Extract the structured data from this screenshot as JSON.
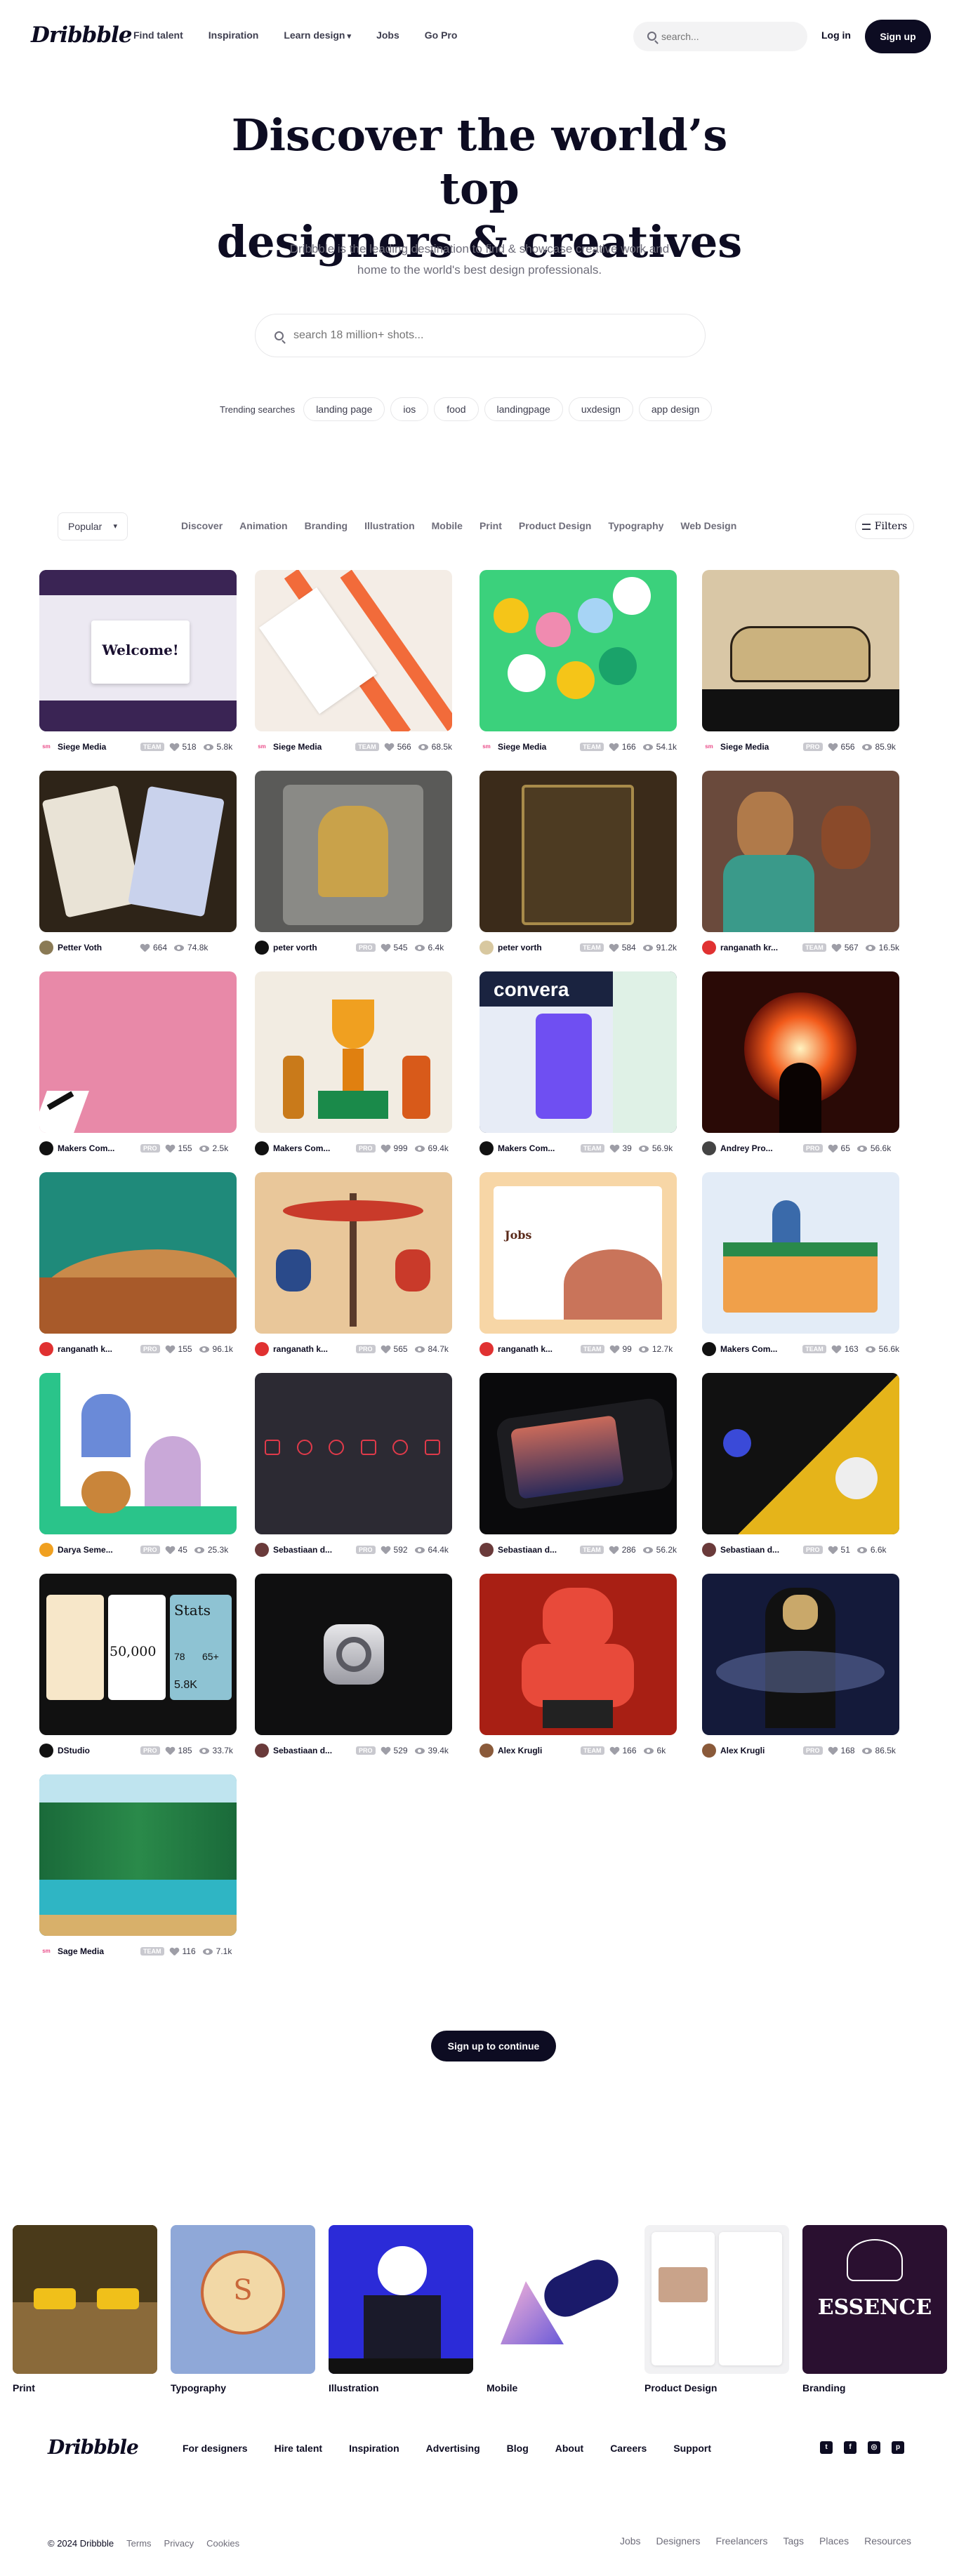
{
  "nav": {
    "logo": "Dribbble",
    "links": [
      "Find talent",
      "Inspiration",
      "Learn design",
      "Jobs",
      "Go Pro"
    ],
    "search_placeholder": "search...",
    "login": "Log in",
    "signup": "Sign up"
  },
  "hero": {
    "title_line1": "Discover the world’s top",
    "title_line2": "designers & creatives",
    "subtitle_line1": "Dribbble is the leading destination to find & showcase creative work and",
    "subtitle_line2": "home to the world's best design professionals.",
    "search_placeholder": "search 18 million+ shots...",
    "trending_label": "Trending searches",
    "trending": [
      "landing page",
      "ios",
      "food",
      "landingpage",
      "uxdesign",
      "app design"
    ]
  },
  "filters": {
    "sort": "Popular",
    "categories": [
      "Discover",
      "Animation",
      "Branding",
      "Illustration",
      "Mobile",
      "Print",
      "Product Design",
      "Typography",
      "Web Design"
    ],
    "filters_label": "Filters"
  },
  "shots": [
    {
      "author": "Siege Media",
      "badge": "TEAM",
      "likes": "518",
      "views": "5.8k",
      "av": "sm",
      "avcolor": "#ffffff",
      "bg": "#3a2454",
      "welcome": "Welcome!"
    },
    {
      "author": "Siege Media",
      "badge": "TEAM",
      "likes": "566",
      "views": "68.5k",
      "av": "sm",
      "avcolor": "#ffffff",
      "bg": "#f4ede6"
    },
    {
      "author": "Siege Media",
      "badge": "TEAM",
      "likes": "166",
      "views": "54.1k",
      "av": "sm",
      "avcolor": "#ffffff",
      "bg": "#3bd17c"
    },
    {
      "author": "Siege Media",
      "badge": "PRO",
      "likes": "656",
      "views": "85.9k",
      "av": "sm",
      "avcolor": "#ffffff",
      "bg": "#d9c7a6"
    },
    {
      "author": "Petter Voth",
      "badge": "",
      "likes": "664",
      "views": "74.8k",
      "av": "",
      "avcolor": "#8a7a55",
      "bg": "#2e2418"
    },
    {
      "author": "peter vorth",
      "badge": "PRO",
      "likes": "545",
      "views": "6.4k",
      "av": "",
      "avcolor": "#111111",
      "bg": "#5a5a58"
    },
    {
      "author": "peter vorth",
      "badge": "TEAM",
      "likes": "584",
      "views": "91.2k",
      "av": "",
      "avcolor": "#d8c8a0",
      "bg": "#3b2b1a"
    },
    {
      "author": "ranganath kr...",
      "badge": "TEAM",
      "likes": "567",
      "views": "16.5k",
      "av": "",
      "avcolor": "#e03131",
      "bg": "#6a4a3c"
    },
    {
      "author": "Makers Com...",
      "badge": "PRO",
      "likes": "155",
      "views": "2.5k",
      "av": "",
      "avcolor": "#111111",
      "bg": "#e889a8"
    },
    {
      "author": "Makers Com...",
      "badge": "PRO",
      "likes": "999",
      "views": "69.4k",
      "av": "",
      "avcolor": "#111111",
      "bg": "#f2ece2"
    },
    {
      "author": "Makers Com...",
      "badge": "TEAM",
      "likes": "39",
      "views": "56.9k",
      "av": "",
      "avcolor": "#111111",
      "bg": "#1a2340",
      "convera": "convera"
    },
    {
      "author": "Andrey Pro...",
      "badge": "PRO",
      "likes": "65",
      "views": "56.6k",
      "av": "",
      "avcolor": "#444444",
      "bg": "#2a0a06"
    },
    {
      "author": "ranganath k...",
      "badge": "PRO",
      "likes": "155",
      "views": "96.1k",
      "av": "",
      "avcolor": "#e03131",
      "bg": "#1f8a7a"
    },
    {
      "author": "ranganath k...",
      "badge": "PRO",
      "likes": "565",
      "views": "84.7k",
      "av": "",
      "avcolor": "#e03131",
      "bg": "#e9c79a"
    },
    {
      "author": "ranganath k...",
      "badge": "TEAM",
      "likes": "99",
      "views": "12.7k",
      "av": "",
      "avcolor": "#e03131",
      "bg": "#f1e4d2",
      "jobs": "Jobs"
    },
    {
      "author": "Makers Com...",
      "badge": "TEAM",
      "likes": "163",
      "views": "56.6k",
      "av": "",
      "avcolor": "#111111",
      "bg": "#e3ecf7"
    },
    {
      "author": "Darya Seme...",
      "badge": "PRO",
      "likes": "45",
      "views": "25.3k",
      "av": "",
      "avcolor": "#f0a020",
      "bg": "#ffffff"
    },
    {
      "author": "Sebastiaan d...",
      "badge": "PRO",
      "likes": "592",
      "views": "64.4k",
      "av": "",
      "avcolor": "#6a3a3a",
      "bg": "#2c2a33"
    },
    {
      "author": "Sebastiaan d...",
      "badge": "TEAM",
      "likes": "286",
      "views": "56.2k",
      "av": "",
      "avcolor": "#6a3a3a",
      "bg": "#0a0a0c"
    },
    {
      "author": "Sebastiaan d...",
      "badge": "PRO",
      "likes": "51",
      "views": "6.6k",
      "av": "",
      "avcolor": "#6a3a3a",
      "bg": "#111111"
    },
    {
      "author": "DStudio",
      "badge": "PRO",
      "likes": "185",
      "views": "33.7k",
      "av": "",
      "avcolor": "#111111",
      "bg": "#111111",
      "big": "50,000",
      "stats": "Stats",
      "n78": "78",
      "n65": "65+",
      "n58": "5.8K"
    },
    {
      "author": "Sebastiaan d...",
      "badge": "PRO",
      "likes": "529",
      "views": "39.4k",
      "av": "",
      "avcolor": "#6a3a3a",
      "bg": "#0f0f10"
    },
    {
      "author": "Alex Krugli",
      "badge": "TEAM",
      "likes": "166",
      "views": "6k",
      "av": "",
      "avcolor": "#8a5a3a",
      "bg": "#a81f14"
    },
    {
      "author": "Alex Krugli",
      "badge": "PRO",
      "likes": "168",
      "views": "86.5k",
      "av": "",
      "avcolor": "#8a5a3a",
      "bg": "#141a3a"
    },
    {
      "author": "Sage Media",
      "badge": "TEAM",
      "likes": "116",
      "views": "7.1k",
      "av": "sm",
      "avcolor": "#ffffff",
      "bg": "#2f9fb0"
    }
  ],
  "continue_label": "Sign up to continue",
  "category_strip": [
    {
      "name": "Print",
      "bg": "#6b4a2a"
    },
    {
      "name": "Typography",
      "bg": "#8fa8d8",
      "seal_word": "S"
    },
    {
      "name": "Illustration",
      "bg": "#2b2bd8"
    },
    {
      "name": "Mobile",
      "bg": "#ffffff"
    },
    {
      "name": "Product Design",
      "bg": "#f1f1f3"
    },
    {
      "name": "Branding",
      "bg": "#2a1030",
      "brand_word": "ESSENCE"
    }
  ],
  "footer": {
    "logo": "Dribbble",
    "links": [
      "For designers",
      "Hire talent",
      "Inspiration",
      "Advertising",
      "Blog",
      "About",
      "Careers",
      "Support"
    ],
    "social_icons": [
      "twitter-icon",
      "facebook-icon",
      "instagram-icon",
      "pinterest-icon"
    ],
    "copyright": "© 2024 Dribbble",
    "legal": [
      "Terms",
      "Privacy",
      "Cookies"
    ],
    "sublinks": [
      "Jobs",
      "Designers",
      "Freelancers",
      "Tags",
      "Places",
      "Resources"
    ]
  }
}
